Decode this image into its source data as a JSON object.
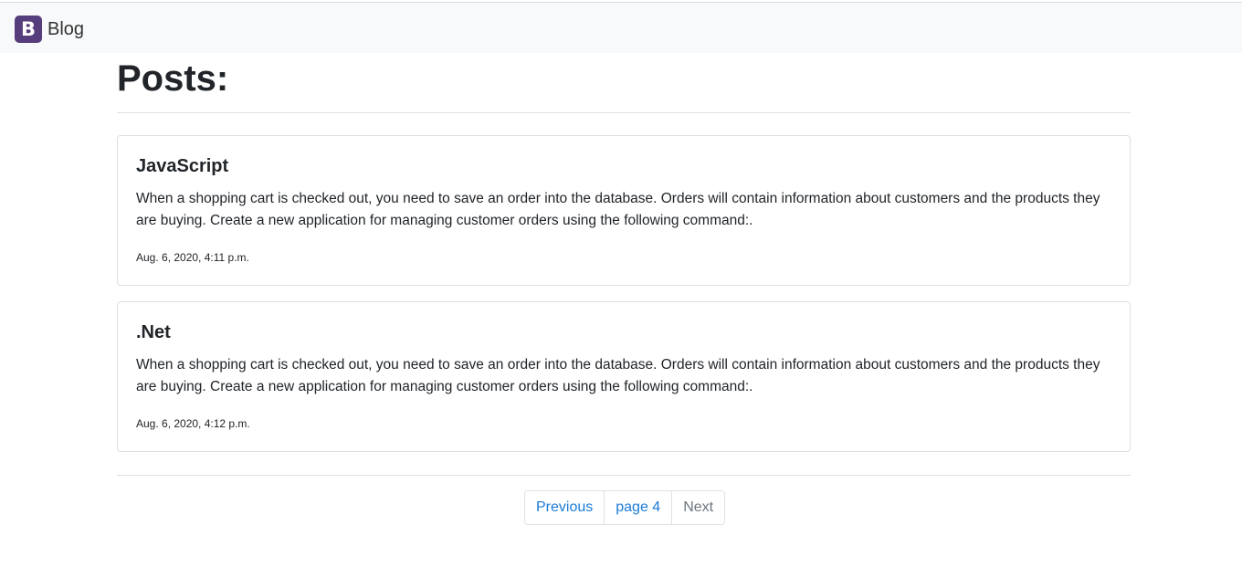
{
  "navbar": {
    "logo_letter": "B",
    "brand": "Blog"
  },
  "page": {
    "heading": "Posts:"
  },
  "posts": [
    {
      "title": "JavaScript",
      "body": "When a shopping cart is checked out, you need to save an order into the database. Orders will contain information about customers and the products they are buying. Create a new application for managing customer orders using the following command:.",
      "date": "Aug. 6, 2020, 4:11 p.m."
    },
    {
      "title": ".Net",
      "body": "When a shopping cart is checked out, you need to save an order into the database. Orders will contain information about customers and the products they are buying. Create a new application for managing customer orders using the following command:.",
      "date": "Aug. 6, 2020, 4:12 p.m."
    }
  ],
  "pagination": {
    "previous": "Previous",
    "current": "page 4",
    "next": "Next"
  },
  "colors": {
    "brand": "#563d7c",
    "link": "#1a7bd8",
    "muted": "#6c757d"
  }
}
